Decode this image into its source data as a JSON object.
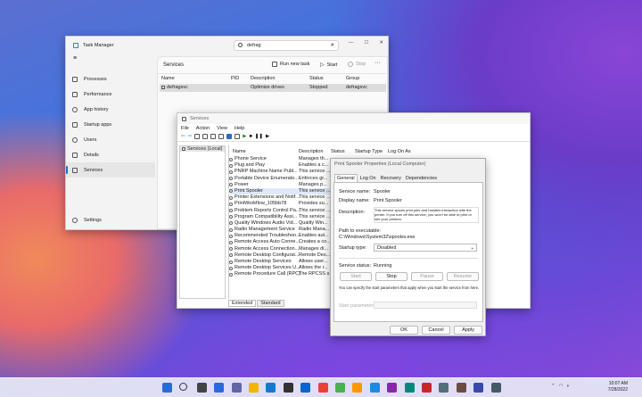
{
  "task_manager": {
    "title": "Task Manager",
    "search_value": "defrag",
    "nav": [
      {
        "label": "Processes",
        "icon": "grid-icon"
      },
      {
        "label": "Performance",
        "icon": "pulse-icon"
      },
      {
        "label": "App history",
        "icon": "history-icon"
      },
      {
        "label": "Startup apps",
        "icon": "rocket-icon"
      },
      {
        "label": "Users",
        "icon": "users-icon"
      },
      {
        "label": "Details",
        "icon": "list-icon"
      },
      {
        "label": "Services",
        "icon": "services-icon"
      }
    ],
    "settings_label": "Settings",
    "page_title": "Services",
    "toolbar": {
      "run_new_task": "Run new task",
      "start": "Start",
      "stop": "Stop"
    },
    "columns": [
      "Name",
      "PID",
      "Description",
      "Status",
      "Group"
    ],
    "row": {
      "name": "defragsvc",
      "pid": "",
      "description": "Optimize drives",
      "status": "Stopped",
      "group": "defragsvc"
    }
  },
  "services_window": {
    "title": "Services",
    "menu": [
      "File",
      "Action",
      "View",
      "Help"
    ],
    "tree_item": "Services (Local)",
    "columns": [
      "Name",
      "Description",
      "Status",
      "Startup Type",
      "Log On As"
    ],
    "names": [
      "Phone Service",
      "Plug and Play",
      "PNRP Machine Name Publ...",
      "Portable Device Enumerato...",
      "Power",
      "Print Spooler",
      "Printer Extensions and Notif...",
      "PrintWorkflow_105bb78",
      "Problem Reports Control Pa...",
      "Program Compatibility Assi...",
      "Quality Windows Audio Vid...",
      "Radio Management Service",
      "Recommended Troubleshoo...",
      "Remote Access Auto Conne...",
      "Remote Access Connection...",
      "Remote Desktop Configurat...",
      "Remote Desktop Services",
      "Remote Desktop Services U...",
      "Remote Procedure Call (RPC)"
    ],
    "descriptions": [
      "Manages th...",
      "Enables a c...",
      "This service ...",
      "Enforces gr...",
      "Manages p...",
      "This service ...",
      "This service ...",
      "Provides su...",
      "This service ...",
      "This service ...",
      "Quality Win...",
      "Radio Mana...",
      "Enables aut...",
      "Creates a co...",
      "Manages di...",
      "Remote Des...",
      "Allows user...",
      "Allows the r...",
      "The RPCSS s..."
    ],
    "tabs": [
      "Extended",
      "Standard"
    ]
  },
  "properties_dialog": {
    "title": "Print Spooler Properties (Local Computer)",
    "tabs": [
      "General",
      "Log On",
      "Recovery",
      "Dependencies"
    ],
    "service_name_label": "Service name:",
    "service_name": "Spooler",
    "display_name_label": "Display name:",
    "display_name": "Print Spooler",
    "description_label": "Description:",
    "description": "This service spools print jobs and handles interaction with the printer. If you turn off this service, you won't be able to print or see your printers.",
    "path_label": "Path to executable:",
    "path": "C:\\Windows\\System32\\spoolsv.exe",
    "startup_label": "Startup type:",
    "startup_value": "Disabled",
    "status_label": "Service status:",
    "status_value": "Running",
    "buttons": [
      "Start",
      "Stop",
      "Pause",
      "Resume"
    ],
    "note": "You can specify the start parameters that apply when you start the service from here.",
    "start_params_label": "Start parameters:",
    "ok": "OK",
    "cancel": "Cancel",
    "apply": "Apply"
  },
  "taskbar": {
    "time": "10:07 AM",
    "date": "7/28/2022",
    "icons": [
      "windows-icon",
      "search-icon",
      "task-view-icon",
      "widgets-icon",
      "chat-icon",
      "explorer-icon",
      "edge-icon",
      "store-icon",
      "mail-icon",
      "chrome-icon",
      "app-icon",
      "app-icon",
      "app-icon",
      "app-icon",
      "app-icon",
      "app-icon",
      "app-icon",
      "app-icon",
      "app-icon",
      "app-icon"
    ]
  }
}
